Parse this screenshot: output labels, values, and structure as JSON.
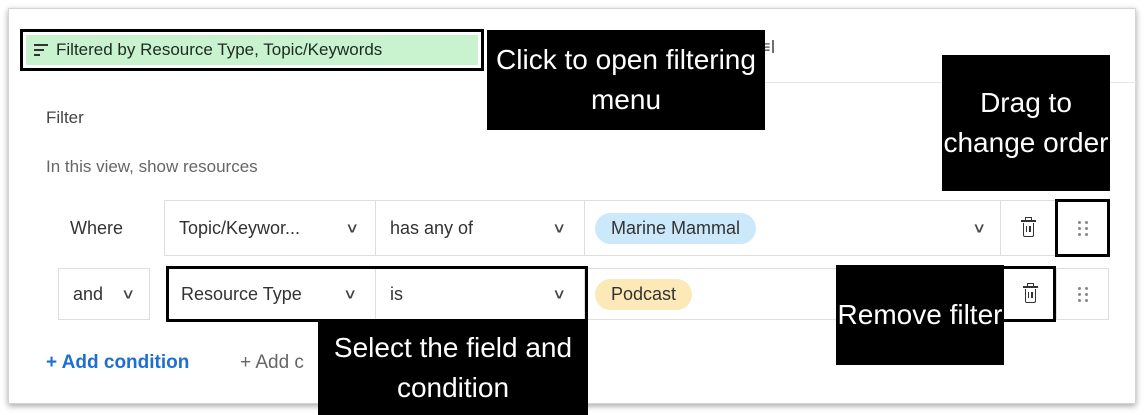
{
  "toolbar": {
    "filter_chip_label": "Filtered by Resource Type, Topic/Keywords",
    "row_height_icon": "≡I"
  },
  "panel": {
    "title": "Filter",
    "subtitle": "In this view, show resources"
  },
  "conditions": [
    {
      "conjunction": "Where",
      "field": "Topic/Keywor...",
      "operator": "has any of",
      "value": "Marine Mammal",
      "value_color": "#cce9fb"
    },
    {
      "conjunction": "and",
      "field": "Resource Type",
      "operator": "is",
      "value": "Podcast",
      "value_color": "#fde8b8"
    }
  ],
  "actions": {
    "add_condition": "+ Add condition",
    "add_group": "+ Add c"
  },
  "callouts": {
    "open_menu": "Click to open filtering menu",
    "drag_order": "Drag to change order",
    "remove_filter": "Remove filter",
    "select_field": "Select the field and condition"
  },
  "icons": {
    "filter": "filter-lines-icon",
    "chevron": "chevron-down-icon",
    "trash": "trash-icon",
    "grip": "drag-handle-icon"
  },
  "colors": {
    "chip_bg": "#c9f2cf",
    "link_blue": "#1f6fd0",
    "callout_bg": "#000000"
  }
}
